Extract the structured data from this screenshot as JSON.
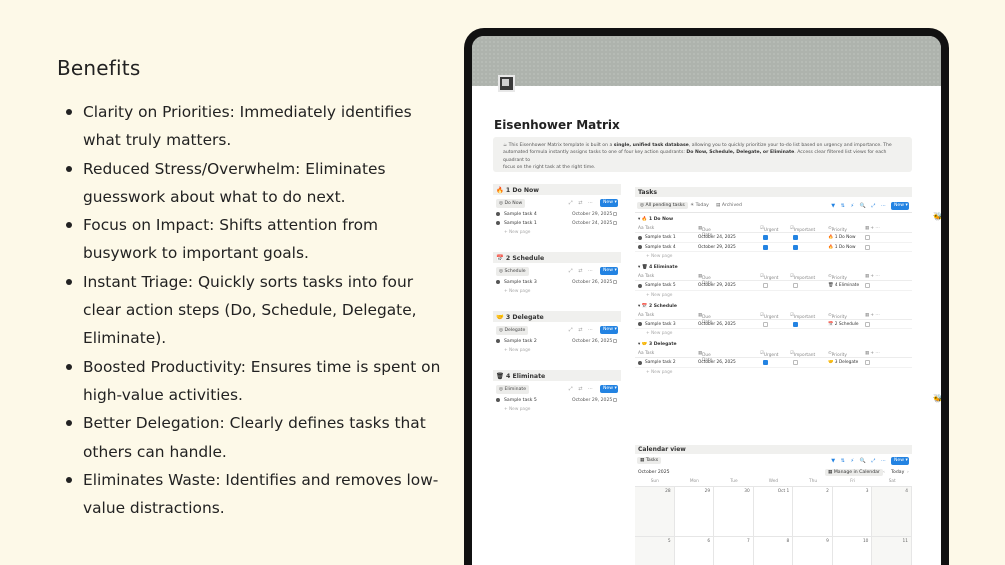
{
  "benefits": {
    "title": "Benefits",
    "items": [
      "Clarity on Priorities: Immediately identifies what truly matters.",
      "Reduced Stress/Overwhelm: Eliminates guesswork about what to do next.",
      "Focus on Impact: Shifts attention from busywork to important goals.",
      "Instant Triage: Quickly sorts tasks into four clear action steps (Do, Schedule, Delegate, Eliminate).",
      "Boosted Productivity: Ensures time is spent on high-value activities.",
      "Better Delegation: Clearly defines tasks that others can handle.",
      "Eliminates Waste: Identifies and removes low-value distractions."
    ]
  },
  "app": {
    "page_title": "Eisenhower Matrix",
    "callout_line1_a": "This Eisenhower Matrix template is built on a ",
    "callout_line1_b": "single, unified task database",
    "callout_line1_c": ", allowing you to quickly prioritize your to-do list based on urgency and importance. The",
    "callout_line2_a": "automated formula instantly assigns tasks to one of four key action quadrants: ",
    "callout_line2_b": "Do Now, Schedule, Delegate, or Eliminate",
    "callout_line2_c": ". Access clear filtered list views for each quadrant to",
    "callout_line3": "focus on the right task at the right time.",
    "new_label": "New",
    "new_page_label": "+ New page",
    "quadrants": [
      {
        "title": "1 Do Now",
        "icon": "🔥",
        "pill": "Do Now",
        "tasks": [
          {
            "name": "Sample task 4",
            "date": "October 29, 2025"
          },
          {
            "name": "Sample task 1",
            "date": "October 24, 2025"
          }
        ]
      },
      {
        "title": "2 Schedule",
        "icon": "📅",
        "pill": "Schedule",
        "tasks": [
          {
            "name": "Sample task 3",
            "date": "October 26, 2025"
          }
        ]
      },
      {
        "title": "3 Delegate",
        "icon": "🤝",
        "pill": "Delegate",
        "tasks": [
          {
            "name": "Sample task 2",
            "date": "October 26, 2025"
          }
        ]
      },
      {
        "title": "4 Eliminate",
        "icon": "🗑",
        "pill": "Eliminate",
        "tasks": [
          {
            "name": "Sample task 5",
            "date": "October 29, 2025"
          }
        ]
      }
    ],
    "tasks": {
      "title": "Tasks",
      "tabs": [
        "All pending tasks",
        "Today",
        "Archived"
      ],
      "columns": [
        "Aa Task",
        "Due Date",
        "Urgent",
        "Important",
        "Priority"
      ],
      "groups": [
        {
          "label": "🔥 1 Do Now",
          "rows": [
            {
              "name": "Sample task 1",
              "date": "October 24, 2025",
              "urgent": true,
              "important": true,
              "priority": "🔥 1 Do Now"
            },
            {
              "name": "Sample task 4",
              "date": "October 29, 2025",
              "urgent": true,
              "important": true,
              "priority": "🔥 1 Do Now"
            }
          ]
        },
        {
          "label": "🗑 4 Eliminate",
          "rows": [
            {
              "name": "Sample task 5",
              "date": "October 29, 2025",
              "urgent": false,
              "important": false,
              "priority": "🗑 4 Eliminate"
            }
          ]
        },
        {
          "label": "📅 2 Schedule",
          "rows": [
            {
              "name": "Sample task 3",
              "date": "October 26, 2025",
              "urgent": false,
              "important": true,
              "priority": "📅 2 Schedule"
            }
          ]
        },
        {
          "label": "🤝 3 Delegate",
          "rows": [
            {
              "name": "Sample task 2",
              "date": "October 26, 2025",
              "urgent": true,
              "important": false,
              "priority": "🤝 3 Delegate"
            }
          ]
        }
      ]
    },
    "calendar": {
      "title": "Calendar view",
      "tab": "Tasks",
      "month": "October 2025",
      "manage": "Manage in Calendar",
      "today": "Today",
      "weekdays": [
        "Sun",
        "Mon",
        "Tue",
        "Wed",
        "Thu",
        "Fri",
        "Sat"
      ],
      "week1": [
        "28",
        "29",
        "30",
        "Oct 1",
        "2",
        "3",
        "4"
      ],
      "week2": [
        "5",
        "6",
        "7",
        "8",
        "9",
        "10",
        "11"
      ]
    }
  }
}
